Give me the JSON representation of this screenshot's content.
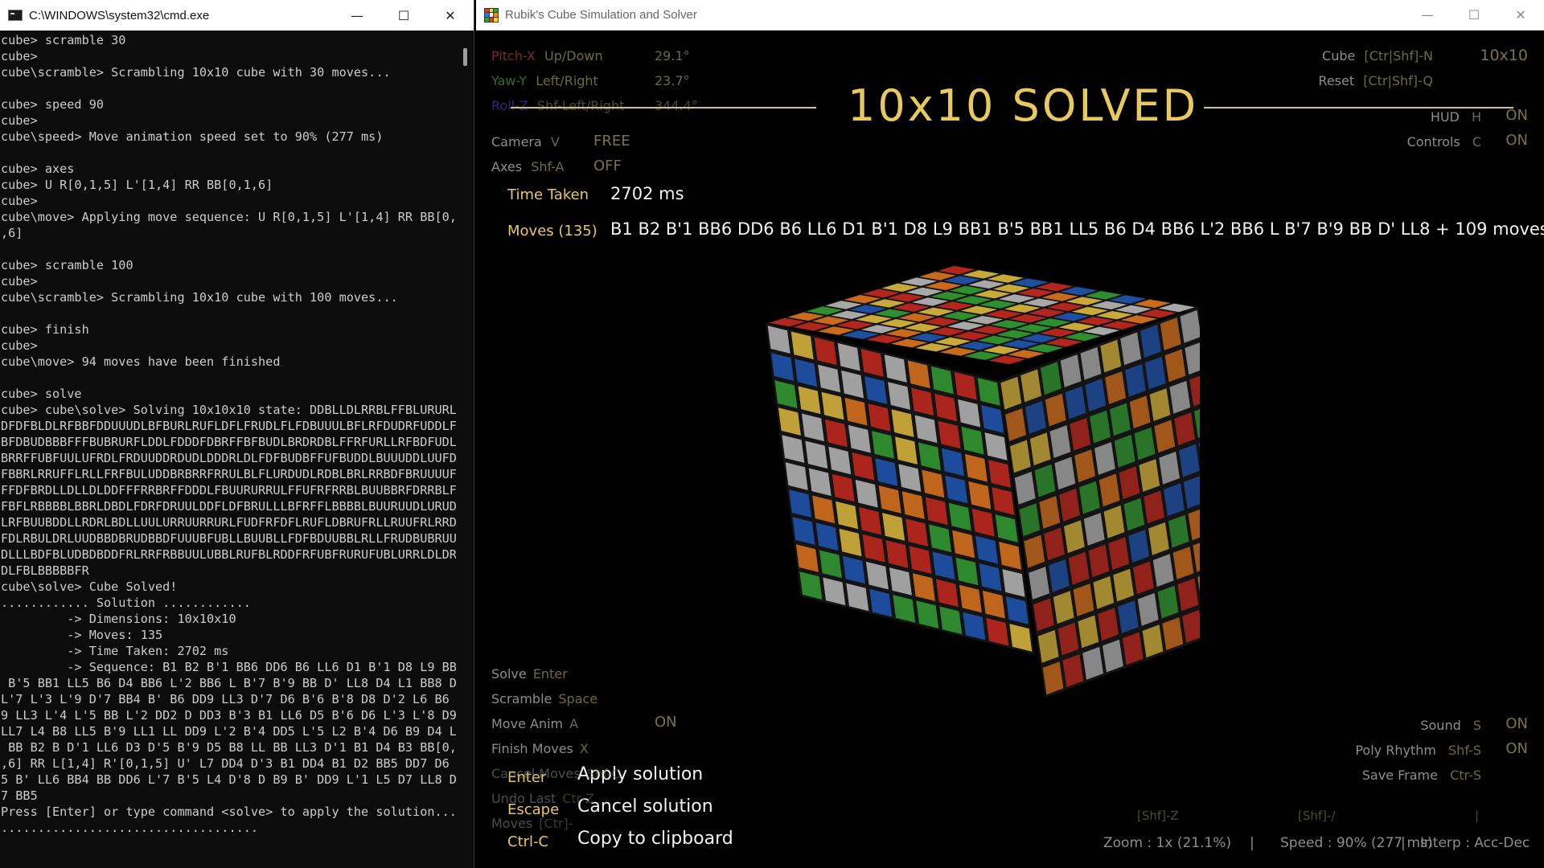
{
  "cmd": {
    "title": "C:\\WINDOWS\\system32\\cmd.exe",
    "lines": [
      "cube> scramble 30",
      "cube>",
      "cube\\scramble> Scrambling 10x10 cube with 30 moves...",
      "",
      "cube> speed 90",
      "cube>",
      "cube\\speed> Move animation speed set to 90% (277 ms)",
      "",
      "cube> axes",
      "cube> U R[0,1,5] L'[1,4] RR BB[0,1,6]",
      "cube>",
      "cube\\move> Applying move sequence: U R[0,1,5] L'[1,4] RR BB[0,1",
      ",6]",
      "",
      "cube> scramble 100",
      "cube>",
      "cube\\scramble> Scrambling 10x10 cube with 100 moves...",
      "",
      "cube> finish",
      "cube>",
      "cube\\move> 94 moves have been finished",
      "",
      "cube> solve",
      "cube> cube\\solve> Solving 10x10x10 state: DDBLLDLRRBLFFBLURURLR",
      "DFDFBLDLRFBBFDDUUUDLBFBURLRUFLDFLFRUDLFLFDBUUULBFLRFDUDRFUDDLFU",
      "BFDBUDBBBFFFBUBRURFLDDLFDDDFDBRFFBFBUDLBRDRDBLFFRFURLLRFBDFUDLD",
      "BRRFFUBFUULUFRDLFRDUUDDRDUDLDDDRLDLFDFBUDBFFUFBUDDLBUUUDDLUUFDB",
      "FBBRLRRUFFLRLLFRFBULUDDBRBRRFRRULBLFLURDUDLRDBLBRLRRBDFBRUUUUFF",
      "FFDFBRDLLDLLDLDDFFFRRBRFFDDDLFBUURURRULFFUFRFRRBLBUUBBRFDRRBLFR",
      "FBFLRBBBBLBBRLDBDLFDRFDRUULDDFLDFBRULLLBFRFFLBBBBLBUURUUDLURUDR",
      "LRFBUUBDDLLRDRLBDLLUULURRUURRURLFUDFRFDFLRUFLDBRUFRLLRUUFRLRRD",
      "FDLRBULDRLUUDBBDBRUDBBDFUUUBFUBLLBUUBLLFDFBDUUBBLRLLFRUDBUBRUUL",
      "DLLLBDFBLUDBDBDDFRLRRFRBBUULUBBLRUFBLRDDFRFUBFRURUFUBLURRLDLDRB",
      "DLFBLBBBBBFR",
      "cube\\solve> Cube Solved!",
      "............ Solution ............",
      "         -> Dimensions: 10x10x10",
      "         -> Moves: 135",
      "         -> Time Taken: 2702 ms",
      "         -> Sequence: B1 B2 B'1 BB6 DD6 B6 LL6 D1 B'1 D8 L9 BB1",
      " B'5 BB1 LL5 B6 D4 BB6 L'2 BB6 L B'7 B'9 BB D' LL8 D4 L1 BB8 D",
      "L'7 L'3 L'9 D'7 BB4 B' B6 DD9 LL3 D'7 D6 B'6 B'8 D8 D'2 L6 B6 B",
      "9 LL3 L'4 L'5 BB L'2 DD2 D DD3 B'3 B1 LL6 D5 B'6 D6 L'3 L'8 D9",
      "LL7 L4 B8 LL5 B'9 LL1 LL DD9 L'2 B'4 DD5 L'5 L2 B'4 D6 B9 D4 L8",
      " BB B2 B D'1 LL6 D3 D'5 B'9 D5 B8 LL BB LL3 D'1 B1 D4 B3 BB[0,1",
      ",6] RR L[1,4] R'[0,1,5] U' L7 DD4 D'3 B1 DD4 B1 D2 BB5 DD7 D6 L",
      "5 B' LL6 BB4 BB DD6 L'7 B'5 L4 D'8 D B9 B' DD9 L'1 L5 D7 LL8 DD",
      "7 BB5",
      "Press [Enter] or type command <solve> to apply the solution...",
      "..................................."
    ]
  },
  "app": {
    "title": "Rubik's Cube Simulation and Solver",
    "banner": "10x10  SOLVED",
    "left_hud": [
      {
        "label": "Pitch-X",
        "key": "Up/Down",
        "value": "29.1°",
        "label_color": "#7a2a2a",
        "key_color": "#6f6a3c"
      },
      {
        "label": "Yaw-Y",
        "key": "Left/Right",
        "value": "23.7°",
        "label_color": "#2f6b2f",
        "key_color": "#6f6a3c"
      },
      {
        "label": "Roll-Z",
        "key": "Shf-Left/Right",
        "value": "344.4°",
        "label_color": "#2a2a7a",
        "key_color": "#4e4a2c"
      }
    ],
    "camera": {
      "label": "Camera",
      "key": "V",
      "value": "FREE"
    },
    "axes": {
      "label": "Axes",
      "key": "Shf-A",
      "value": "OFF"
    },
    "right_hud": {
      "cube": {
        "label": "Cube",
        "key": "[Ctr|Shf]-N",
        "value": "10x10"
      },
      "reset": {
        "label": "Reset",
        "key": "[Ctr|Shf]-Q"
      },
      "hud": {
        "label": "HUD",
        "key": "H",
        "value": "ON"
      },
      "controls": {
        "label": "Controls",
        "key": "C",
        "value": "ON"
      }
    },
    "time_taken": {
      "label": "Time Taken",
      "value": "2702  ms"
    },
    "moves": {
      "label": "Moves (135)",
      "value": "B1 B2 B'1 BB6 DD6 B6 LL6 D1 B'1 D8 L9 BB1 B'5 BB1 LL5 B6 D4 BB6 L'2 BB6 L B'7 B'9 BB D' LL8 + 109 moves"
    },
    "bottom_left": [
      {
        "label": "Solve",
        "key": "Enter",
        "value": ""
      },
      {
        "label": "Scramble",
        "key": "Space",
        "value": ""
      },
      {
        "label": "Move Anim",
        "key": "A",
        "value": "ON"
      },
      {
        "label": "Finish Moves",
        "key": "X",
        "value": ""
      },
      {
        "label": "Cancel Moves",
        "key": "Shf-C",
        "value": ""
      },
      {
        "label": "Undo Last",
        "key": "Ctr-Z",
        "value": ""
      },
      {
        "label": "Moves",
        "key": "[Ctr]-",
        "value": ""
      }
    ],
    "bottom_right": {
      "sound": {
        "label": "Sound",
        "key": "S",
        "value": "ON"
      },
      "poly": {
        "label": "Poly Rhythm",
        "key": "Shf-S",
        "value": "ON"
      },
      "save": {
        "label": "Save Frame",
        "key": "Ctr-S"
      },
      "shf_z": "[Shf]-Z",
      "shf_slash": "[Shf]-/",
      "pipe": "|"
    },
    "hints": [
      {
        "key": "Enter",
        "text": "Apply solution"
      },
      {
        "key": "Escape",
        "text": "Cancel solution"
      },
      {
        "key": "Ctrl-C",
        "text": "Copy to clipboard"
      }
    ],
    "status": {
      "zoom": "Zoom : 1x (21.1%)",
      "speed": "Speed : 90% (277 ms)",
      "interp": "Interp : Acc-Dec",
      "sep": "|"
    },
    "colors": {
      "accent": "#e8c95d",
      "sticker_white": "#a8a8a8",
      "sticker_yellow": "#c9a93a",
      "sticker_red": "#b3261e",
      "sticker_orange": "#c96a1c",
      "sticker_blue": "#1f4fa3",
      "sticker_green": "#2f8f2f"
    }
  }
}
